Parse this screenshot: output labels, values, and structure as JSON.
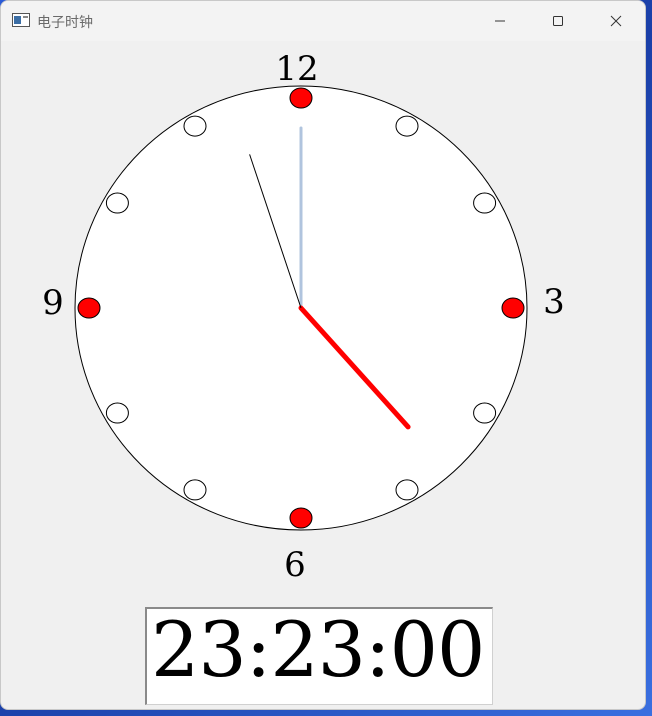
{
  "window": {
    "title": "电子时钟"
  },
  "clock": {
    "labels": {
      "twelve": "12",
      "three": "3",
      "six": "6",
      "nine": "9"
    },
    "time": {
      "hour": 23,
      "minute": 23,
      "second": 0
    },
    "colors": {
      "face": "#ffffff",
      "major_marker": "#ff0000",
      "minor_marker": "#ffffff",
      "hour_hand": "#000000",
      "minute_hand": "#ff0000",
      "second_hand": "#b0c4de"
    }
  },
  "digital": {
    "time_text": "23:23:00"
  },
  "icons": {
    "app": "window-app-icon",
    "minimize": "minimize-icon",
    "maximize": "maximize-icon",
    "close": "close-icon"
  }
}
